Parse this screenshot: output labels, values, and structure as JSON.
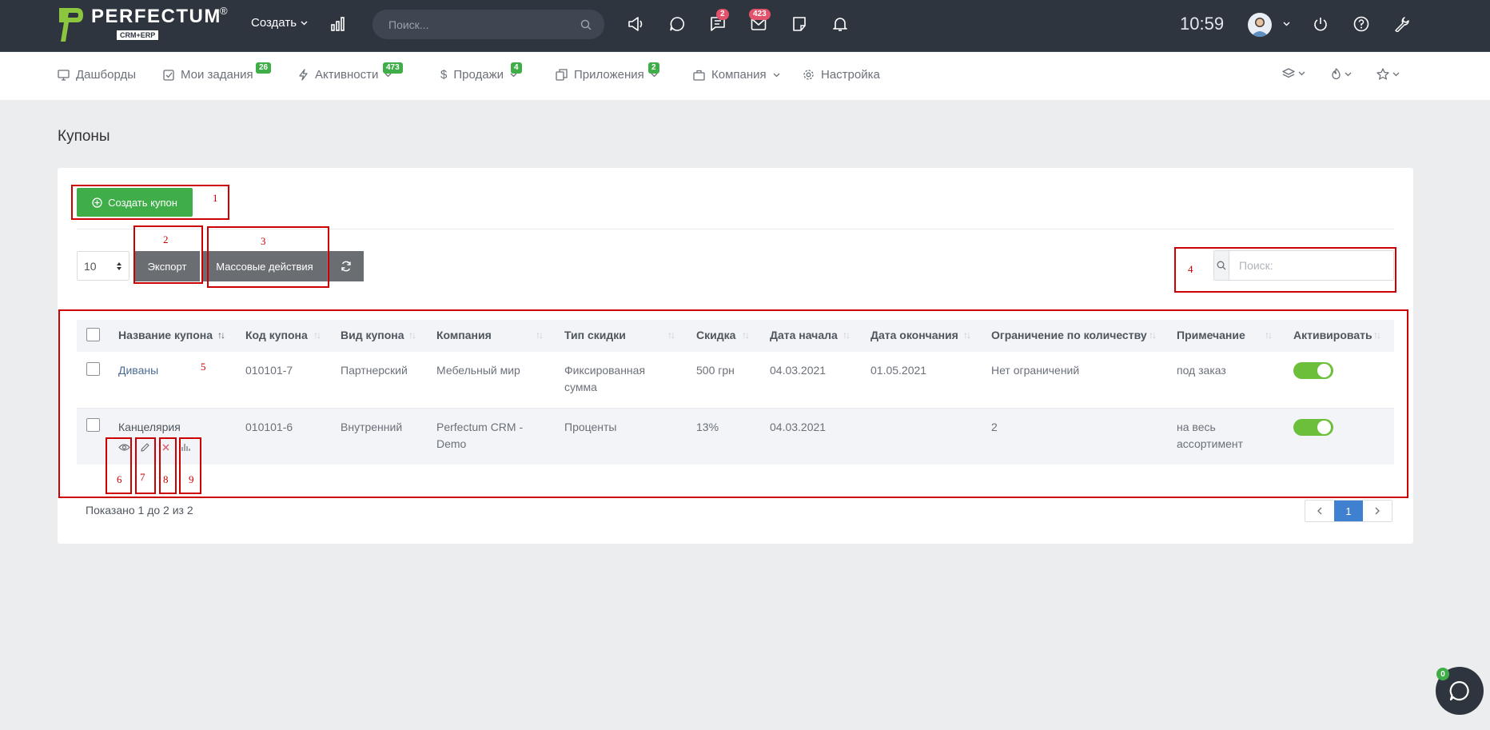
{
  "brand": {
    "name": "PERFECTUM",
    "sub": "CRM+ERP",
    "reg": "®"
  },
  "topbar": {
    "create_label": "Создать",
    "search_placeholder": "Поиск...",
    "messages_badge": "2",
    "mail_badge": "423",
    "time": "10:59"
  },
  "nav": {
    "items": [
      {
        "label": "Дашборды"
      },
      {
        "label": "Мои задания",
        "badge": "26"
      },
      {
        "label": "Активности",
        "badge": "473"
      },
      {
        "label": "Продажи",
        "badge": "4"
      },
      {
        "label": "Приложения",
        "badge": "2"
      },
      {
        "label": "Компания"
      },
      {
        "label": "Настройка"
      }
    ]
  },
  "page": {
    "title": "Купоны",
    "create_button": "Создать купон",
    "page_length": "10",
    "export_button": "Экспорт",
    "bulk_button": "Массовые действия",
    "search_placeholder": "Поиск:",
    "info": "Показано 1 до 2 из 2",
    "current_page": "1"
  },
  "table": {
    "headers": [
      "Название купона",
      "Код купона",
      "Вид купона",
      "Компания",
      "Тип скидки",
      "Скидка",
      "Дата начала",
      "Дата окончания",
      "Ограничение по количеству",
      "Примечание",
      "Активировать"
    ],
    "rows": [
      {
        "name": "Диваны",
        "code": "010101-7",
        "kind": "Партнерский",
        "company": "Мебельный мир",
        "discount_type_1": "Фиксированная",
        "discount_type_2": "сумма",
        "discount": "500 грн",
        "start": "04.03.2021",
        "end": "01.05.2021",
        "limit": "Нет ограничений",
        "note_1": "под заказ",
        "note_2": "",
        "active": true
      },
      {
        "name": "Канцелярия",
        "code": "010101-6",
        "kind": "Внутренний",
        "company_1": "Perfectum CRM -",
        "company_2": "Demo",
        "discount_type_1": "Проценты",
        "discount": "13%",
        "start": "04.03.2021",
        "end": "",
        "limit": "2",
        "note_1": "на весь",
        "note_2": "ассортимент",
        "active": true
      }
    ]
  },
  "annotations": [
    "1",
    "2",
    "3",
    "4",
    "5",
    "6",
    "7",
    "8",
    "9"
  ],
  "chat": {
    "badge": "0"
  },
  "colors": {
    "topbar": "#2e353e",
    "green": "#3fae49",
    "badge_red": "#e2536b",
    "annotation": "#cc0000",
    "pager_active": "#3f81d0"
  }
}
